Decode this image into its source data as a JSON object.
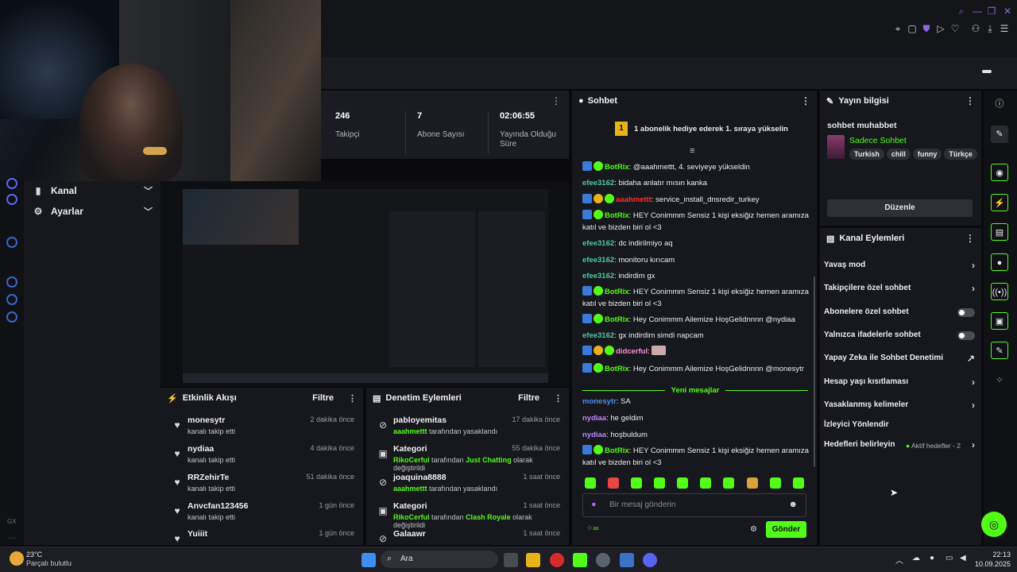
{
  "stats": [
    {
      "value": "246",
      "label": "Takipçi"
    },
    {
      "value": "7",
      "label": "Abone Sayısı"
    },
    {
      "value": "02:06:55",
      "label": "Yayında Olduğu Süre"
    }
  ],
  "leftnav": {
    "items": [
      {
        "label": "Kanal"
      },
      {
        "label": "Ayarlar"
      }
    ]
  },
  "activity": {
    "title": "Etkinlik Akışı",
    "filter": "Filtre",
    "items": [
      {
        "name": "monesytr",
        "sub": "kanalı takip etti",
        "time": "2 dakika önce"
      },
      {
        "name": "nydiaa",
        "sub": "kanalı takip etti",
        "time": "4 dakika önce"
      },
      {
        "name": "RRZehirTe",
        "sub": "kanalı takip etti",
        "time": "51 dakika önce"
      },
      {
        "name": "Anvcfan123456",
        "sub": "kanalı takip etti",
        "time": "1 gün önce"
      },
      {
        "name": "Yuiiit",
        "sub": "",
        "time": "1 gün önce"
      }
    ]
  },
  "moderation": {
    "title": "Denetim Eylemleri",
    "filter": "Filtre",
    "items": [
      {
        "name": "pabloyemitas",
        "actor": "aaahmettt",
        "rest": " tarafından yasaklandı",
        "time": "17 dakika önce"
      },
      {
        "name": "Kategori",
        "actor": "RikoCerful",
        "mid": " tarafından ",
        "target": "Just Chatting",
        "rest": " olarak değiştirildi",
        "time": "55 dakika önce"
      },
      {
        "name": "joaquina8888",
        "actor": "aaahmettt",
        "rest": " tarafından yasaklandı",
        "time": "1 saat önce"
      },
      {
        "name": "Kategori",
        "actor": "RikoCerful",
        "mid": " tarafından ",
        "target": "Clash Royale",
        "rest": " olarak değiştirildi",
        "time": "1 saat önce"
      },
      {
        "name": "Galaawr",
        "actor": "",
        "rest": "",
        "time": "1 saat önce"
      }
    ]
  },
  "chat": {
    "title": "Sohbet",
    "banner": "1 abonelik hediye ederek 1. sıraya yükselin",
    "new_messages": "Yeni mesajlar",
    "placeholder": "Bir mesaj gönderin",
    "send": "Gönder",
    "messages": [
      {
        "user": "BotRix",
        "color": "#53fc18",
        "badges": [
          "blue",
          "green"
        ],
        "text": "@aaahmettt, 4. seviyeye yükseldin"
      },
      {
        "user": "efee3162",
        "color": "#4ec9a1",
        "badges": [],
        "text": "bidaha anlatır mısın kanka"
      },
      {
        "user": "aaahmettt",
        "color": "#ff2e2e",
        "badges": [
          "blue",
          "gold",
          "green"
        ],
        "text": "service_install_dnsredir_turkey"
      },
      {
        "user": "BotRix",
        "color": "#53fc18",
        "badges": [
          "blue",
          "green"
        ],
        "text": "HEY Conimmm Sensiz 1 kişi eksiğiz hemen aramıza katıl ve bizden biri ol <3"
      },
      {
        "user": "efee3162",
        "color": "#4ec9a1",
        "badges": [],
        "text": "dc indirilmiyo aq"
      },
      {
        "user": "efee3162",
        "color": "#4ec9a1",
        "badges": [],
        "text": "monitoru kırıcam"
      },
      {
        "user": "efee3162",
        "color": "#4ec9a1",
        "badges": [],
        "text": "indirdim gx"
      },
      {
        "user": "BotRix",
        "color": "#53fc18",
        "badges": [
          "blue",
          "green"
        ],
        "text": "HEY Conimmm Sensiz 1 kişi eksiğiz hemen aramıza katıl ve bizden biri ol <3"
      },
      {
        "user": "BotRix",
        "color": "#53fc18",
        "badges": [
          "blue",
          "green"
        ],
        "text": "Hey Conimmm Ailemize HoşGelidnnnn @nydiaa"
      },
      {
        "user": "efee3162",
        "color": "#4ec9a1",
        "badges": [],
        "text": "gx indirdim simdi napcam"
      },
      {
        "user": "didcerful",
        "color": "#ff8bd8",
        "badges": [
          "blue",
          "gold",
          "green"
        ],
        "text": ""
      },
      {
        "user": "BotRix",
        "color": "#53fc18",
        "badges": [
          "blue",
          "green"
        ],
        "text": "Hey Conimmm Ailemize HoşGelidnnnn @monesytr"
      }
    ],
    "new": [
      {
        "user": "monesytr",
        "color": "#4f8cf7",
        "badges": [],
        "text": "SA"
      },
      {
        "user": "nydiaa",
        "color": "#b78cf7",
        "badges": [],
        "text": "he geldim"
      },
      {
        "user": "nydiaa",
        "color": "#b78cf7",
        "badges": [],
        "text": "hoşbuldum"
      },
      {
        "user": "BotRix",
        "color": "#53fc18",
        "badges": [
          "blue",
          "green"
        ],
        "text": "HEY Conimmm Sensiz 1 kişi eksiğiz hemen aramıza katıl ve bizden biri ol <3"
      }
    ]
  },
  "streaminfo": {
    "title": "Yayın bilgisi",
    "stream_title": "sohbet muhabbet",
    "category": "Sadece Sohbet",
    "tags": [
      "Turkish",
      "chill",
      "funny",
      "Türkçe"
    ],
    "edit": "Düzenle"
  },
  "actions": {
    "title": "Kanal Eylemleri",
    "items": [
      {
        "label": "Yavaş mod",
        "kind": "chev"
      },
      {
        "label": "Takipçilere özel sohbet",
        "kind": "chev"
      },
      {
        "label": "Abonelere özel sohbet",
        "kind": "toggle"
      },
      {
        "label": "Yalnızca ifadelerle sohbet",
        "kind": "toggle"
      },
      {
        "label": "Yapay Zeka ile Sohbet Denetimi",
        "kind": "ext"
      },
      {
        "label": "Hesap yaşı kısıtlaması",
        "kind": "chev"
      },
      {
        "label": "Yasaklanmış kelimeler",
        "kind": "chev"
      },
      {
        "label": "İzleyici Yönlendir",
        "kind": "none"
      },
      {
        "label": "Hedefleri belirleyin",
        "kind": "chev"
      }
    ],
    "goals_status": "Aktif hedefler - 2"
  },
  "taskbar": {
    "weather_temp": "23°C",
    "weather_desc": "Parçalı bulutlu",
    "search": "Ara",
    "time": "22:13",
    "date": "10.09.2025"
  },
  "rail": {
    "gx": "GX"
  },
  "colors": {
    "accent": "#53fc18",
    "bg": "#17181d"
  }
}
